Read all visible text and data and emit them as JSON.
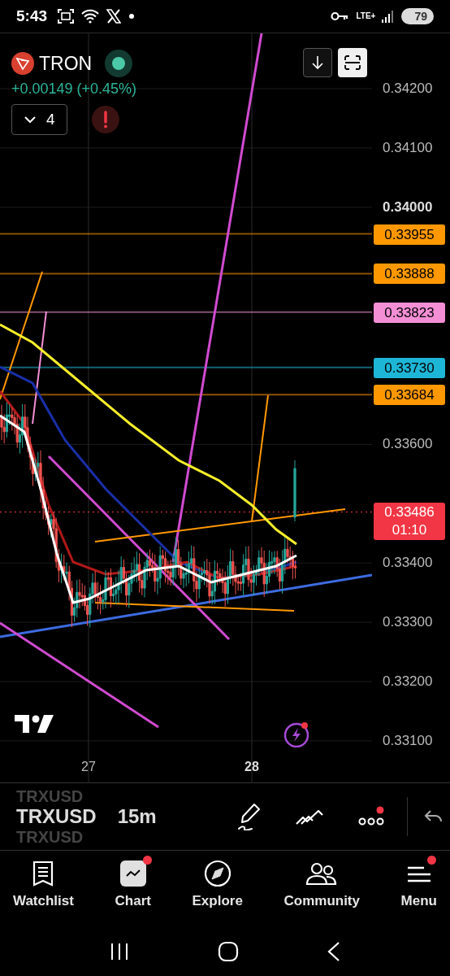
{
  "status_bar": {
    "time": "5:43",
    "network": "LTE+",
    "battery": "79"
  },
  "symbol": {
    "name": "TRON",
    "change": "+0.00149 (+0.45%)",
    "indicators_count": "4",
    "warning": true
  },
  "price_axis": [
    {
      "label": "0.34200",
      "emphasized": false
    },
    {
      "label": "0.34100",
      "emphasized": false
    },
    {
      "label": "0.34000",
      "emphasized": true
    },
    {
      "label": "0.33600",
      "emphasized": false
    },
    {
      "label": "0.33400",
      "emphasized": false
    },
    {
      "label": "0.33300",
      "emphasized": false
    },
    {
      "label": "0.33200",
      "emphasized": false
    },
    {
      "label": "0.33100",
      "emphasized": false
    }
  ],
  "price_tags": [
    {
      "price": "0.33955",
      "color": "#ff9800"
    },
    {
      "price": "0.33888",
      "color": "#ff9800"
    },
    {
      "price": "0.33823",
      "color": "#f48fd6"
    },
    {
      "price": "0.33730",
      "color": "#1eb6d6"
    },
    {
      "price": "0.33684",
      "color": "#ff9800"
    }
  ],
  "last_price": {
    "price": "0.33486",
    "countdown": "01:10"
  },
  "time_axis": [
    {
      "label": "27",
      "emphasized": false
    },
    {
      "label": "28",
      "emphasized": true
    }
  ],
  "toolbar": {
    "ticker_above": "TRXUSD",
    "ticker": "TRXUSD",
    "ticker_below": "TRXUSD",
    "interval": "15m",
    "more_badge": true
  },
  "nav": [
    {
      "label": "Watchlist",
      "selected": false,
      "badge": false
    },
    {
      "label": "Chart",
      "selected": true,
      "badge": true
    },
    {
      "label": "Explore",
      "selected": false,
      "badge": false
    },
    {
      "label": "Community",
      "selected": false,
      "badge": false
    },
    {
      "label": "Menu",
      "selected": false,
      "badge": true
    }
  ]
}
